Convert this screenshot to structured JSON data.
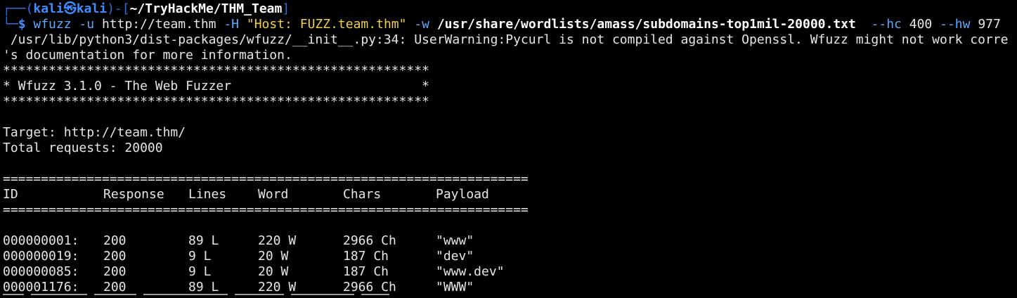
{
  "prompt": {
    "top_corner": "┌──",
    "open_paren": "(",
    "user": "kali",
    "at_glyph": "㉿",
    "host": "kali",
    "close_dash": ")-[",
    "path": "~/TryHackMe/THM_Team",
    "close_bracket": "]",
    "bottom_corner": "└─",
    "dollar": "$"
  },
  "command": {
    "bin": "wfuzz",
    "flag_u": "-u",
    "url": "http://team.thm",
    "flag_h": "-H",
    "header": "\"Host: FUZZ.team.thm\"",
    "flag_w": "-w",
    "wordlist": "/usr/share/wordlists/amass/subdomains-top1mil-20000.txt",
    "flag_hc": "--hc",
    "hc_val": "400",
    "flag_hw": "--hw",
    "hw_val": "977"
  },
  "warning": {
    "line1": " /usr/lib/python3/dist-packages/wfuzz/__init__.py:34: UserWarning:Pycurl is not compiled against Openssl. Wfuzz might not work corre",
    "line2": "'s documentation for more information."
  },
  "banner": {
    "stars": "********************************************************",
    "title_line": "* Wfuzz 3.1.0 - The Web Fuzzer                         *"
  },
  "info": {
    "target": "Target: http://team.thm/",
    "total": "Total requests: 20000"
  },
  "table": {
    "rule": "=====================================================================",
    "headers": {
      "id": "ID",
      "response": "Response",
      "lines": "Lines",
      "word": "Word",
      "chars": "Chars",
      "payload": "Payload"
    },
    "rows": [
      {
        "id": "000000001:",
        "response": "200",
        "lines": "89 L",
        "word": "220 W",
        "chars": "2966 Ch",
        "payload": "\"www\""
      },
      {
        "id": "000000019:",
        "response": "200",
        "lines": "9 L",
        "word": "20 W",
        "chars": "187 Ch",
        "payload": "\"dev\""
      },
      {
        "id": "000000085:",
        "response": "200",
        "lines": "9 L",
        "word": "20 W",
        "chars": "187 Ch",
        "payload": "\"www.dev\""
      },
      {
        "id": "000001176:",
        "response": "200",
        "lines": "89 L",
        "word": "220 W",
        "chars": "2966 Ch",
        "payload": "\"WWW\""
      }
    ]
  },
  "colors": {
    "background": "#000000",
    "text": "#e6e6e6",
    "prompt_blue": "#3f8cff",
    "string_yellow": "#f1d14b"
  }
}
